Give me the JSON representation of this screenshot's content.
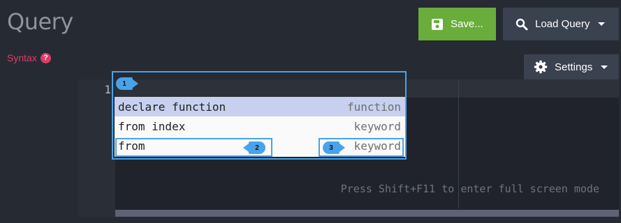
{
  "header": {
    "title": "Query",
    "syntax_label": "Syntax",
    "help_icon": "?",
    "save_label": "Save...",
    "load_label": "Load Query",
    "settings_label": "Settings"
  },
  "editor": {
    "line_number": "1",
    "hint": "Press Shift+F11 to enter full screen mode"
  },
  "autocomplete": [
    {
      "name": "declare function",
      "meta": "function"
    },
    {
      "name": "from index",
      "meta": "keyword"
    },
    {
      "name": "from",
      "meta": "keyword"
    }
  ],
  "callouts": {
    "one": "1",
    "two": "2",
    "three": "3"
  },
  "colors": {
    "accent": "#48a3ea",
    "save": "#6aad3b",
    "syntax": "#e13a68"
  }
}
